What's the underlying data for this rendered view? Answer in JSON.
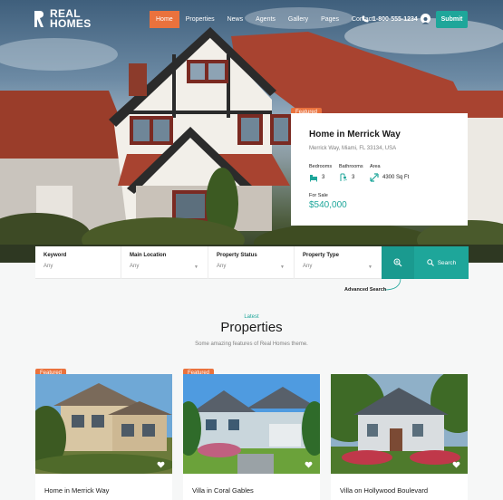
{
  "brand": {
    "line1": "REAL",
    "line2": "HOMES"
  },
  "nav": {
    "items": [
      "Home",
      "Properties",
      "News",
      "Agents",
      "Gallery",
      "Pages",
      "Contact"
    ],
    "active": "Home"
  },
  "header": {
    "phone": "1-800-555-1234",
    "submit_label": "Submit"
  },
  "featured": {
    "badge": "Featured",
    "title": "Home in Merrick Way",
    "address": "Merrick Way, Miami, FL 33134, USA",
    "bedrooms_label": "Bedrooms",
    "bedrooms": "3",
    "bathrooms_label": "Bathrooms",
    "bathrooms": "3",
    "area_label": "Area",
    "area": "4300 Sq Ft",
    "status": "For Sale",
    "price": "$540,000"
  },
  "search": {
    "fields": [
      {
        "label": "Keyword",
        "value": "Any"
      },
      {
        "label": "Main Location",
        "value": "Any"
      },
      {
        "label": "Property Status",
        "value": "Any"
      },
      {
        "label": "Property Type",
        "value": "Any"
      }
    ],
    "search_label": "Search",
    "advanced_label": "Advanced Search"
  },
  "section": {
    "subtitle": "Latest",
    "title": "Properties",
    "description": "Some amazing features of Real Homes theme."
  },
  "listings": [
    {
      "badge": "Featured",
      "title": "Home in Merrick Way"
    },
    {
      "badge": "Featured",
      "title": "Villa in Coral Gables"
    },
    {
      "badge": "",
      "title": "Villa on Hollywood Boulevard"
    }
  ],
  "colors": {
    "accent": "#1ea69a",
    "badge": "#ea723d"
  }
}
